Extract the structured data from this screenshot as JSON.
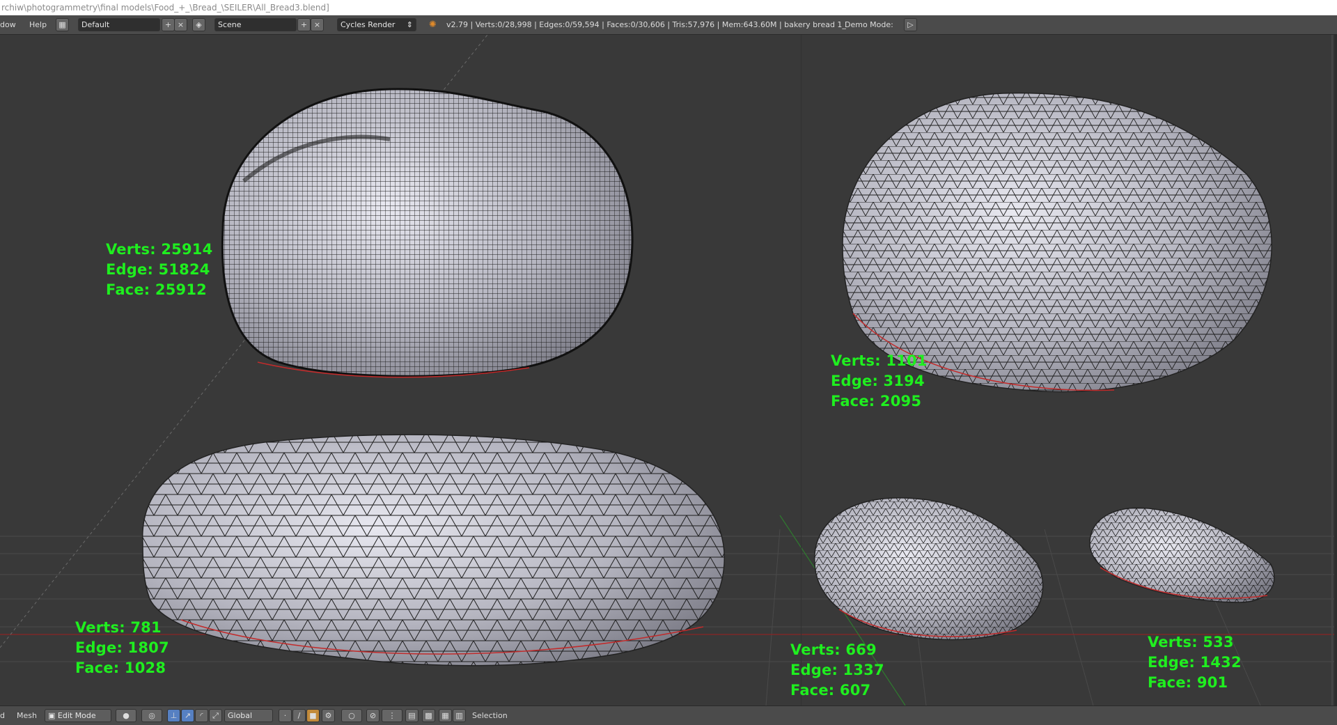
{
  "window": {
    "title": "rchiw\\photogrammetry\\final models\\Food_+_\\Bread_\\SEILER\\All_Bread3.blend]"
  },
  "menu": {
    "window_label": "dow",
    "help_label": "Help",
    "layout_value": "Default",
    "scene_value": "Scene",
    "render_engine": "Cycles Render",
    "stats_line": "v2.79 | Verts:0/28,998 | Edges:0/59,594 | Faces:0/30,606 | Tris:57,976 | Mem:643.60M | bakery bread 1_",
    "demo_mode_label": "Demo Mode:"
  },
  "annotations": [
    {
      "verts": "Verts: 25914",
      "edge": "Edge: 51824",
      "face": "Face: 25912"
    },
    {
      "verts": "Verts: 1101",
      "edge": "Edge: 3194",
      "face": "Face: 2095"
    },
    {
      "verts": "Verts: 781",
      "edge": "Edge: 1807",
      "face": "Face: 1028"
    },
    {
      "verts": "Verts: 669",
      "edge": "Edge: 1337",
      "face": "Face: 607"
    },
    {
      "verts": "Verts: 533",
      "edge": "Edge: 1432",
      "face": "Face: 901"
    }
  ],
  "footer": {
    "view_label": "d",
    "mesh_label": "Mesh",
    "mode_value": "Edit Mode",
    "orientation_value": "Global",
    "selection_label": "Selection"
  },
  "colors": {
    "annotation_green": "#1fef1f",
    "viewport_bg": "#393939",
    "header_bg": "#4b4b4b",
    "mesh_fill": "#b9b9c4",
    "mesh_wire": "#1a1a1a",
    "edge_red": "#c22b2b"
  }
}
